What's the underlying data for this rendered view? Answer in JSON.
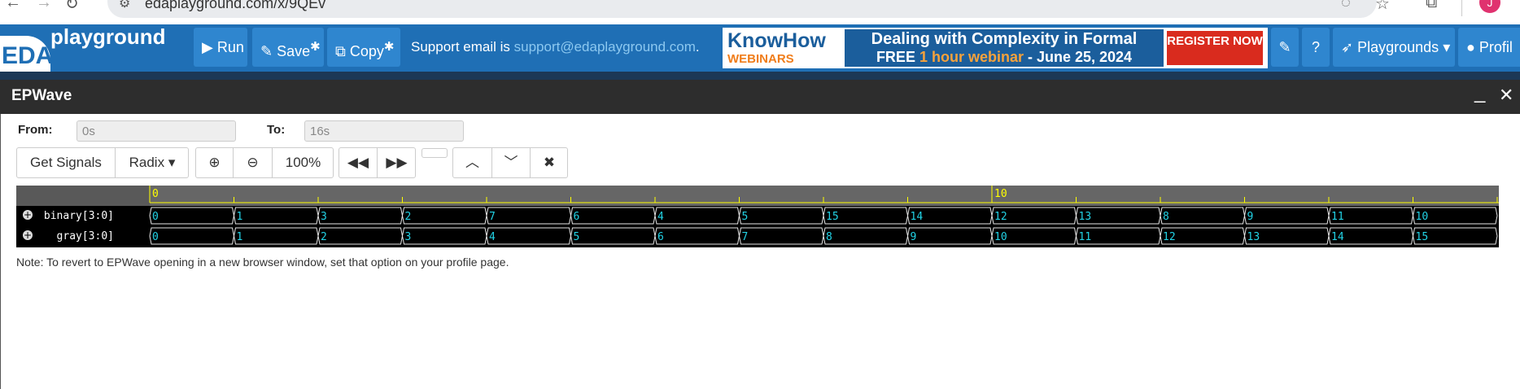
{
  "browser": {
    "url": "edaplayground.com/x/9QEv",
    "avatar_letter": "J"
  },
  "header": {
    "logo_eda": "EDA",
    "logo_playground": "playground",
    "run_label": "Run",
    "save_label": "Save",
    "copy_label": "Copy",
    "support_prefix": "Support email is ",
    "support_email": "support@edaplayground.com",
    "support_suffix": ".",
    "playgrounds_label": "Playgrounds",
    "profile_label": "Profil"
  },
  "banner": {
    "know": "KnowHow",
    "webinars": "WEBINARS",
    "line1": "Dealing with Complexity in Formal",
    "line2_free": "FREE ",
    "line2_hl": "1 hour webinar",
    "line2_date": " - June 25, 2024",
    "register": "REGISTER NOW"
  },
  "epwave": {
    "title": "EPWave",
    "from_label": "From:",
    "from_value": "0s",
    "to_label": "To:",
    "to_value": "16s",
    "get_signals": "Get Signals",
    "radix": "Radix",
    "zoom": "100%",
    "note": "Note: To revert to EPWave opening in a new browser window, set that option on your profile page."
  },
  "waveform": {
    "time_markers": [
      "0",
      "10"
    ],
    "signals": [
      {
        "name": "binary[3:0]",
        "values": [
          "0",
          "1",
          "3",
          "2",
          "7",
          "6",
          "4",
          "5",
          "15",
          "14",
          "12",
          "13",
          "8",
          "9",
          "11",
          "10"
        ]
      },
      {
        "name": "gray[3:0]",
        "values": [
          "0",
          "1",
          "2",
          "3",
          "4",
          "5",
          "6",
          "7",
          "8",
          "9",
          "10",
          "11",
          "12",
          "13",
          "14",
          "15"
        ]
      }
    ],
    "colors": {
      "value": "#22d3e6",
      "marker": "#ffff00",
      "edge": "#e6e6e6"
    }
  }
}
